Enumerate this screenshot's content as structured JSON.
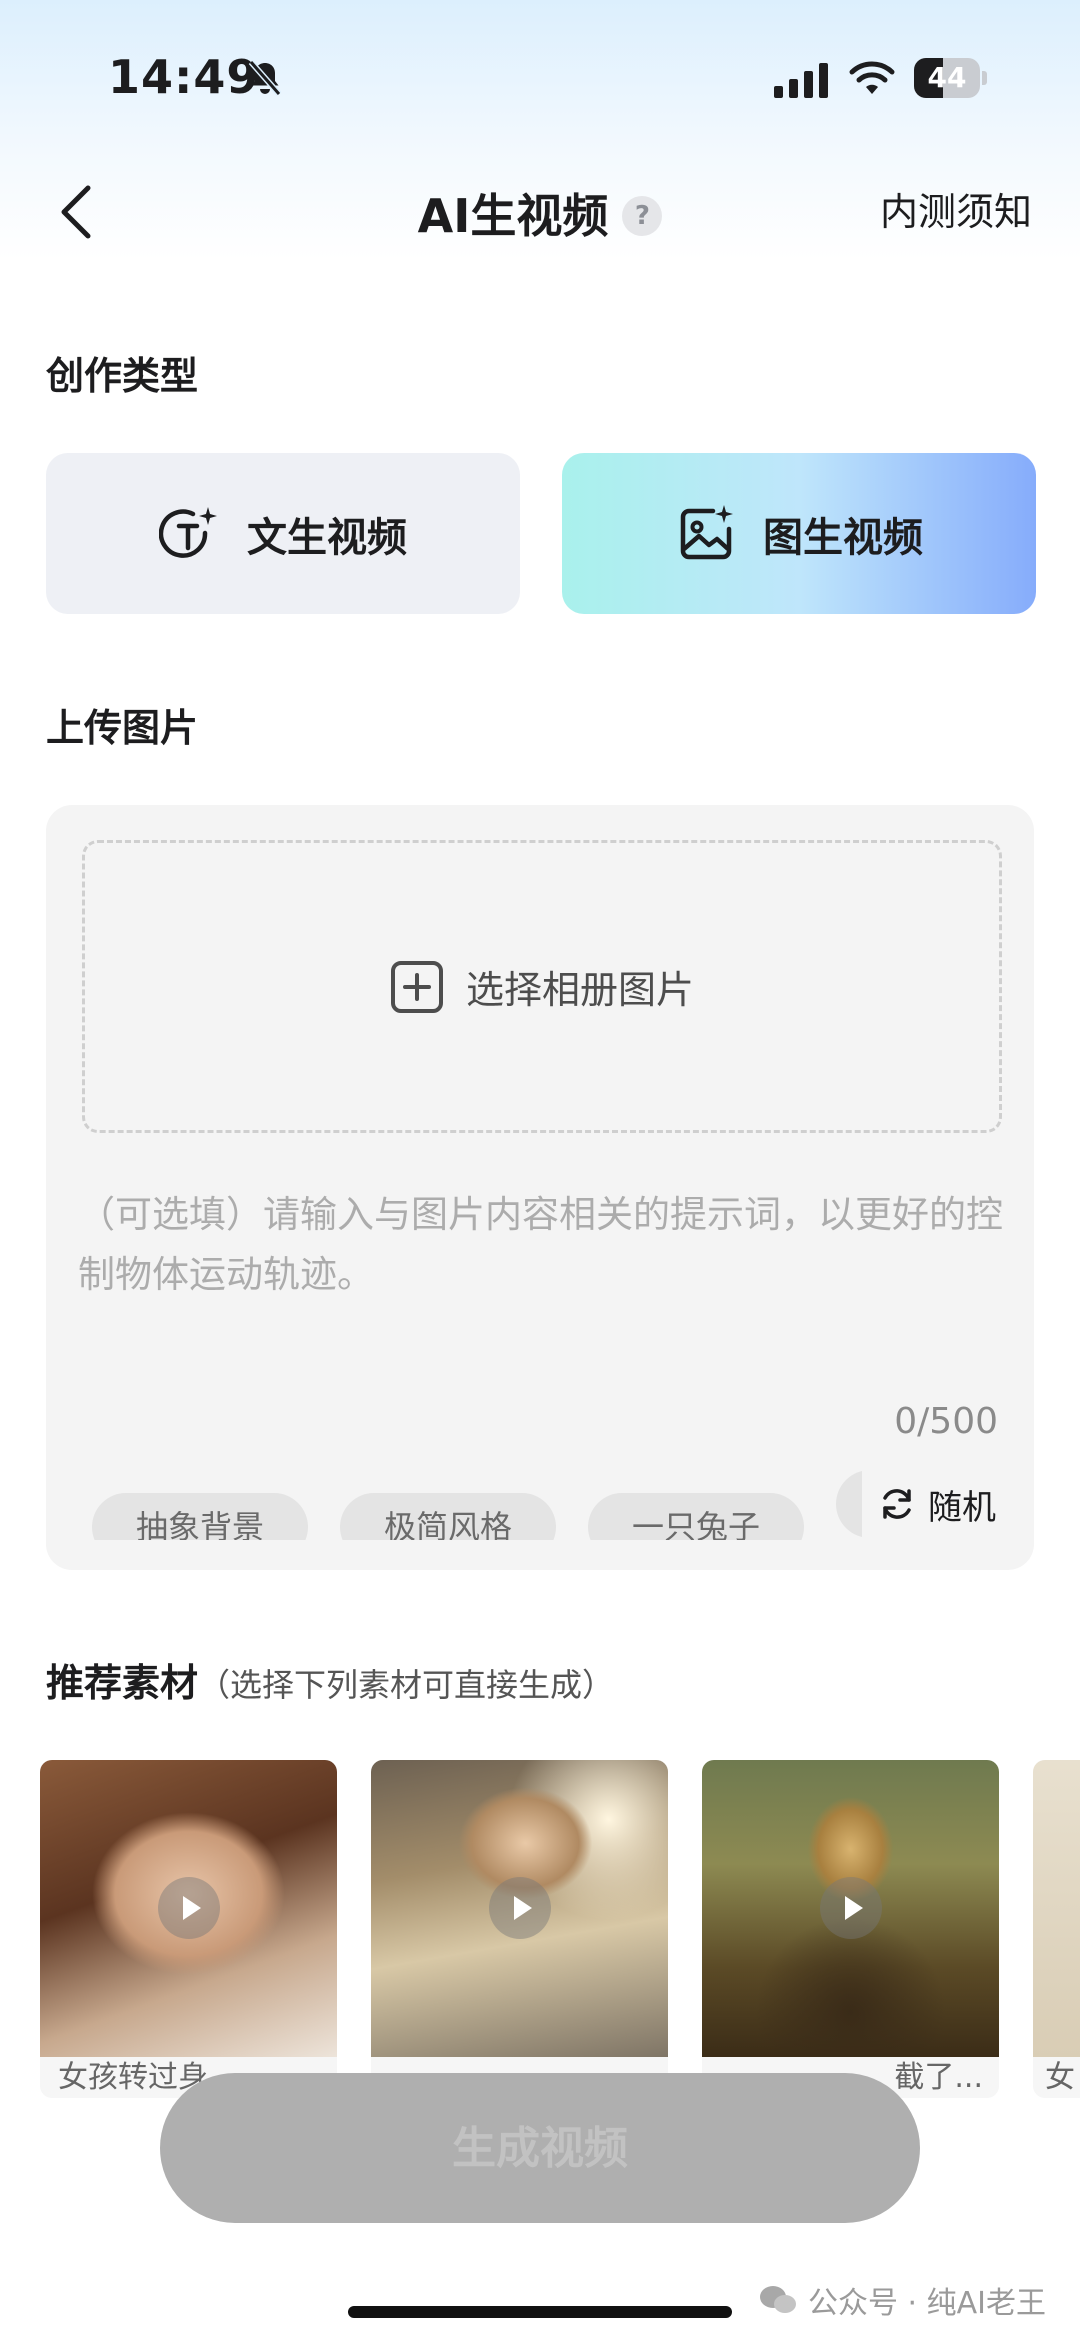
{
  "status_bar": {
    "time": "14:49",
    "battery": "44",
    "battery_level": 0.44,
    "icons": [
      "bell-muted-icon",
      "signal-icon",
      "wifi-icon",
      "battery-icon"
    ]
  },
  "nav": {
    "back_icon": "chevron-left-icon",
    "title": "AI生视频",
    "help": "?",
    "notice": "内测须知"
  },
  "creation_type": {
    "label": "创作类型",
    "options": [
      {
        "label": "文生视频",
        "icon": "text-sparkle-icon",
        "selected": false
      },
      {
        "label": "图生视频",
        "icon": "image-sparkle-icon",
        "selected": true
      }
    ]
  },
  "upload": {
    "label": "上传图片",
    "select_label": "选择相册图片",
    "prompt_placeholder": "（可选填）请输入与图片内容相关的提示词，以更好的控制物体运动轨迹。",
    "counter": "0/500",
    "chips": [
      "抽象背景",
      "极简风格",
      "一只兔子",
      ""
    ],
    "random_label": "随机"
  },
  "recommend": {
    "title": "推荐素材",
    "hint": "（选择下列素材可直接生成）",
    "items": [
      {
        "caption": "女孩转过身"
      },
      {
        "caption": ""
      },
      {
        "caption": "截了..."
      },
      {
        "caption": "女"
      }
    ]
  },
  "generate_label": "生成视频",
  "watermark": "公众号 · 纯AI老王",
  "colors": {
    "selected_gradient_start": "#a9f1ec",
    "selected_gradient_end": "#86acfb",
    "panel_bg": "#f4f4f4",
    "disabled_button": "#afafaf"
  }
}
